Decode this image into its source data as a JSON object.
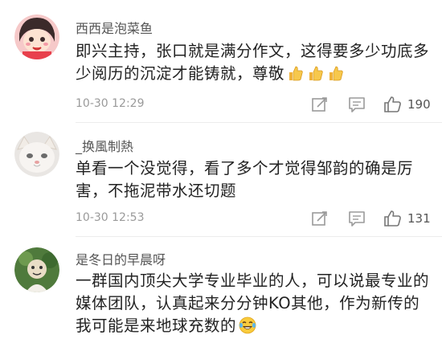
{
  "comments": [
    {
      "username": "西西是泡菜鱼",
      "content": "即兴主持，张口就是满分作文，这得要多少功底多少阅历的沉淀才能铸就，尊敬",
      "emoji": "thumbs-up-emoji",
      "emoji_count": 3,
      "timestamp": "10-30 12:29",
      "likes": "190"
    },
    {
      "username": "_换風制熱",
      "content": "单看一个没觉得，看了多个才觉得邹韵的确是厉害，不拖泥带水还切题",
      "timestamp": "10-30 12:53",
      "likes": "131"
    },
    {
      "username": "是冬日的早晨呀",
      "content": "一群国内顶尖大学专业毕业的人，可以说最专业的媒体团队，认真起来分分钟KO其他，作为新传的我可能是来地球充数的",
      "emoji": "laughing-tears-emoji"
    }
  ],
  "icons": {
    "share": "share-edit-icon",
    "reply": "comment-bubble-icon",
    "like": "thumbs-up-icon"
  },
  "colors": {
    "username": "#555555",
    "text": "#222222",
    "meta": "#9a9a9a",
    "icon": "#9a9a9a"
  }
}
